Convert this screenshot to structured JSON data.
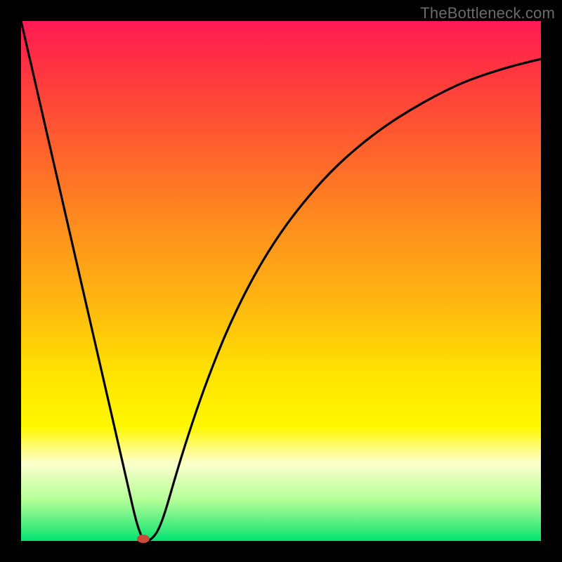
{
  "attribution": "TheBottleneck.com",
  "chart_data": {
    "type": "line",
    "title": "",
    "xlabel": "",
    "ylabel": "",
    "xlim": [
      0,
      100
    ],
    "ylim": [
      0,
      100
    ],
    "series": [
      {
        "name": "curve",
        "x": [
          0,
          5,
          10,
          15,
          20,
          23,
          25,
          27,
          30,
          33,
          36,
          40,
          45,
          50,
          55,
          60,
          65,
          70,
          75,
          80,
          85,
          90,
          95,
          100
        ],
        "y": [
          100,
          78.3,
          56.5,
          34.8,
          13.0,
          0,
          0,
          3.0,
          13.5,
          23.0,
          31.5,
          41.5,
          51.5,
          59.5,
          66.0,
          71.5,
          76.0,
          79.8,
          83.0,
          85.8,
          88.2,
          90.0,
          91.5,
          92.7
        ]
      }
    ],
    "marker": {
      "x": 23.5,
      "y": 0
    },
    "gradient_stops": [
      {
        "pct": 0,
        "color": "#ff1a55"
      },
      {
        "pct": 8,
        "color": "#ff3142"
      },
      {
        "pct": 22,
        "color": "#ff5a30"
      },
      {
        "pct": 38,
        "color": "#ff8a1e"
      },
      {
        "pct": 55,
        "color": "#ffb910"
      },
      {
        "pct": 68,
        "color": "#ffe400"
      },
      {
        "pct": 78,
        "color": "#fff700"
      },
      {
        "pct": 85,
        "color": "#fdffcc"
      },
      {
        "pct": 92,
        "color": "#b6ff9a"
      },
      {
        "pct": 98,
        "color": "#35e97a"
      },
      {
        "pct": 100,
        "color": "#00e573"
      }
    ]
  }
}
